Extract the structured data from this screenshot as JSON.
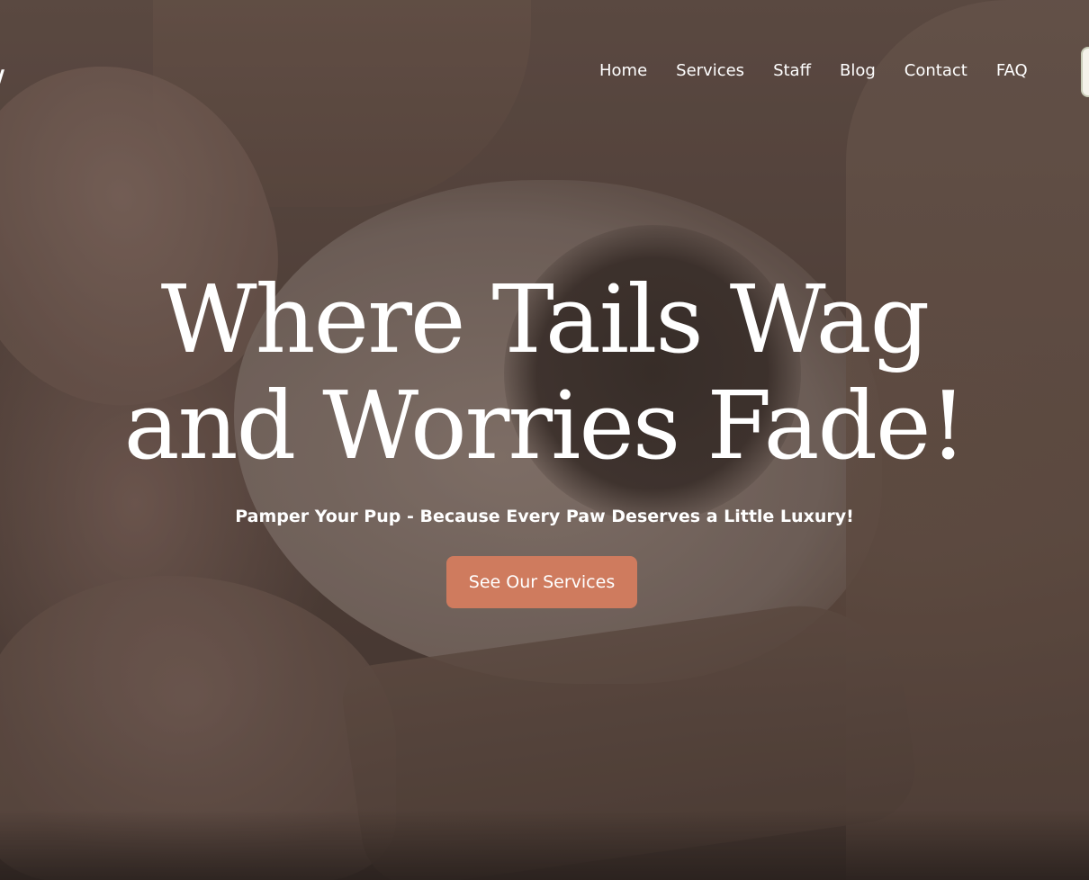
{
  "header": {
    "logo_fragment": "/",
    "nav": [
      {
        "label": "Home"
      },
      {
        "label": "Services"
      },
      {
        "label": "Staff"
      },
      {
        "label": "Blog"
      },
      {
        "label": "Contact"
      },
      {
        "label": "FAQ"
      }
    ]
  },
  "hero": {
    "title_line1": "Where Tails Wag",
    "title_line2": "and Worries Fade!",
    "subtitle": "Pamper Your Pup - Because Every Paw Deserves a Little Luxury!",
    "cta_label": "See Our Services",
    "background_image": "puppy-held-in-arms-photo"
  },
  "colors": {
    "accent": "#cf7b5e",
    "text": "#ffffff",
    "overlay": "#5d4b43"
  }
}
